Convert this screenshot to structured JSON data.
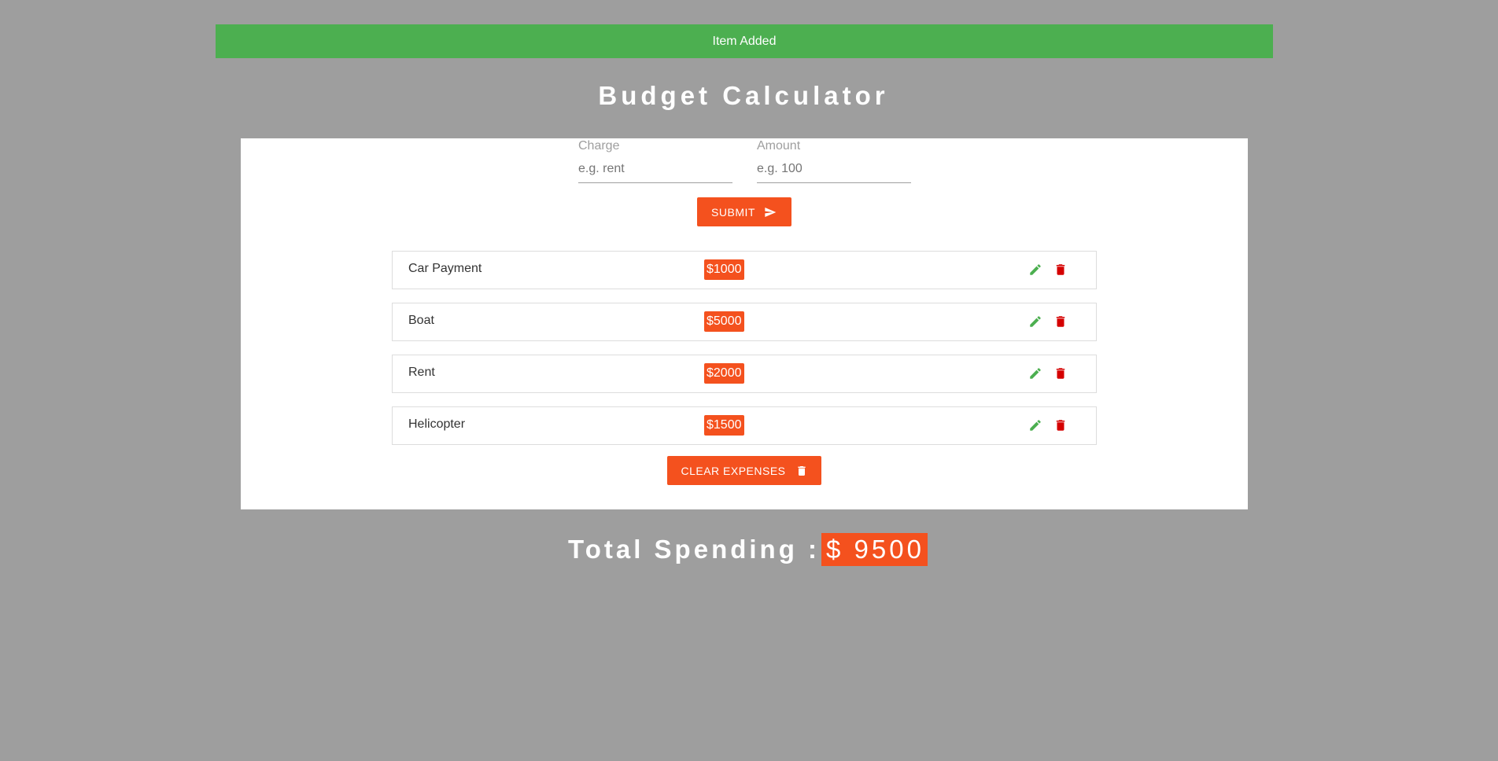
{
  "alert": {
    "text": "Item Added"
  },
  "title": "Budget Calculator",
  "form": {
    "charge": {
      "label": "Charge",
      "placeholder": "e.g. rent",
      "value": ""
    },
    "amount": {
      "label": "Amount",
      "placeholder": "e.g. 100",
      "value": ""
    },
    "submit_label": "SUBMIT"
  },
  "expenses": [
    {
      "name": "Car Payment",
      "amount": "$1000"
    },
    {
      "name": "Boat",
      "amount": "$5000"
    },
    {
      "name": "Rent",
      "amount": "$2000"
    },
    {
      "name": "Helicopter",
      "amount": "$1500"
    }
  ],
  "clear_label": "CLEAR EXPENSES",
  "total": {
    "label": "Total Spending :",
    "amount": "$ 9500"
  },
  "icons": {
    "submit": "send-icon",
    "edit": "pencil-icon",
    "delete": "trash-icon",
    "clear": "trash-icon"
  },
  "colors": {
    "background": "#9e9e9e",
    "alert": "#4caf50",
    "accent": "#f4511e",
    "edit": "#4caf50",
    "delete": "#d50000"
  }
}
